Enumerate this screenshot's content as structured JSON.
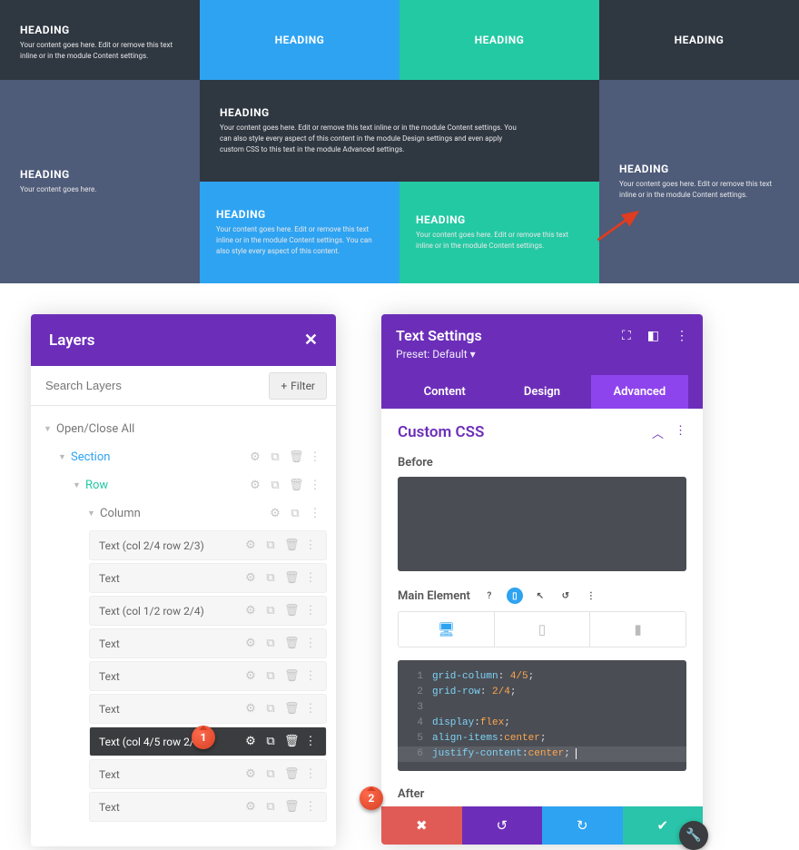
{
  "preview": {
    "heading": "HEADING",
    "body_short": "Your content goes here.",
    "body_inline": "Your content goes here. Edit or remove this text inline or in the module Content settings.",
    "body_long": "Your content goes here. Edit or remove this text inline or in the module Content settings. You can also style every aspect of this content in the module Design settings and even apply custom CSS to this text in the module Advanced settings.",
    "body_mid": "Your content goes here. Edit or remove this text inline or in the module Content settings. You can also style every aspect of this content."
  },
  "layers": {
    "title": "Layers",
    "search_placeholder": "Search Layers",
    "filter_label": "Filter",
    "open_close_all": "Open/Close All",
    "section": "Section",
    "row": "Row",
    "column": "Column",
    "items": [
      "Text (col 2/4 row 2/3)",
      "Text",
      "Text (col 1/2 row 2/4)",
      "Text",
      "Text",
      "Text",
      "Text (col 4/5 row 2/4)",
      "Text",
      "Text"
    ],
    "selected_index": 6,
    "badge_1": "1"
  },
  "settings": {
    "title": "Text Settings",
    "preset": "Preset: Default",
    "tabs": [
      "Content",
      "Design",
      "Advanced"
    ],
    "active_tab": 2,
    "section_title": "Custom CSS",
    "before_label": "Before",
    "main_element_label": "Main Element",
    "after_label": "After",
    "badge_2": "2",
    "code_lines": [
      {
        "n": 1,
        "prop": "grid-column",
        "val": "4/5",
        "sep": ": ",
        "end": ";"
      },
      {
        "n": 2,
        "prop": "grid-row",
        "val": "2/4",
        "sep": ": ",
        "end": ";"
      },
      {
        "n": 3,
        "raw": ""
      },
      {
        "n": 4,
        "prop": "display",
        "val": "flex",
        "sep": ":",
        "end": ";"
      },
      {
        "n": 5,
        "prop": "align-items",
        "val": "center",
        "sep": ":",
        "end": ";"
      },
      {
        "n": 6,
        "prop": "justify-content",
        "val": "center",
        "sep": ":",
        "end": ";",
        "cursor": true
      }
    ]
  }
}
